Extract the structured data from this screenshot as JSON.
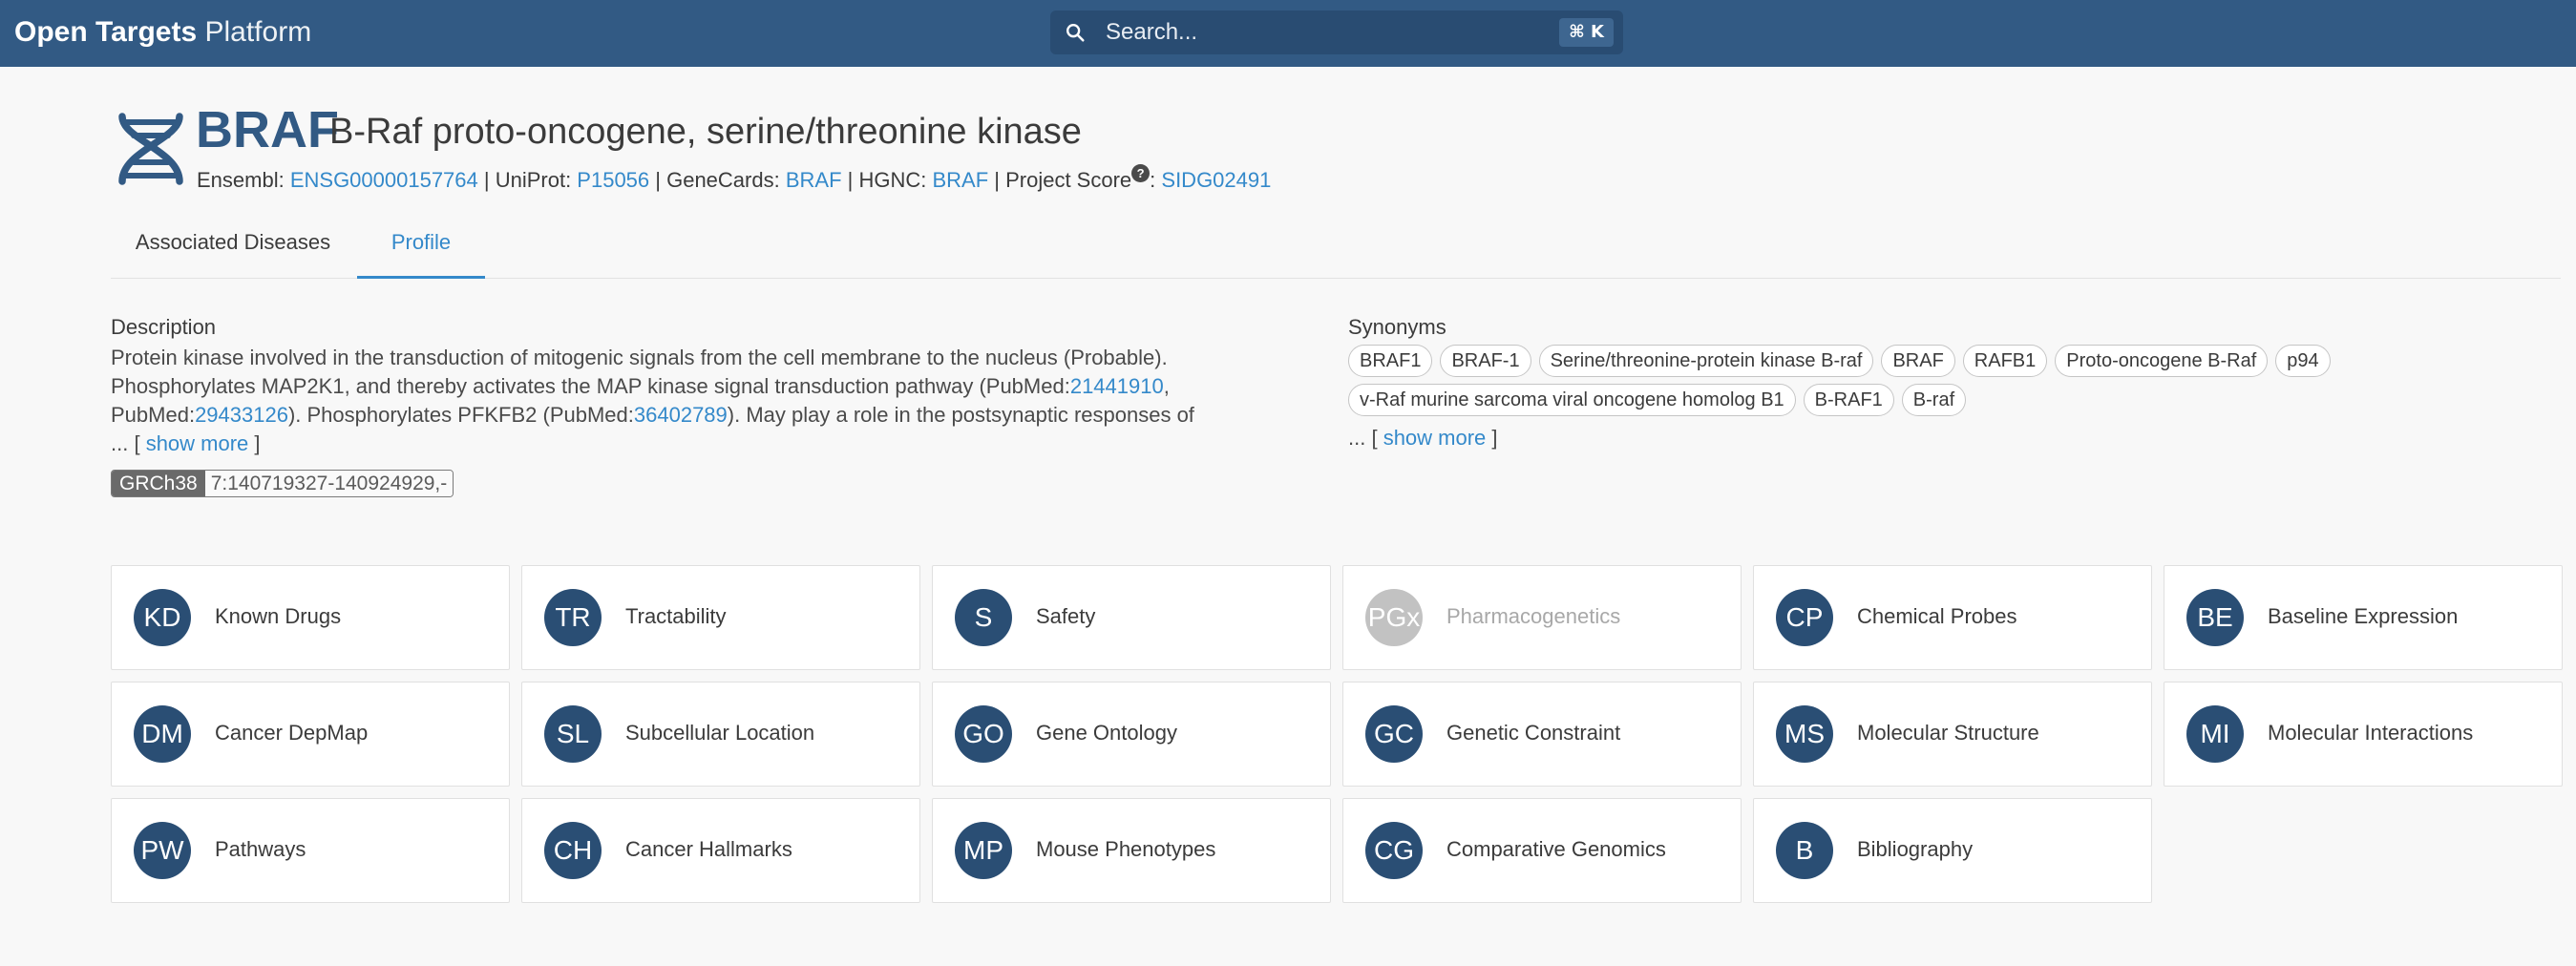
{
  "app": {
    "brand_bold": "Open Targets",
    "brand_light": " Platform"
  },
  "search": {
    "placeholder": "Search...",
    "shortcut": "⌘ K",
    "icon": "search-icon"
  },
  "target": {
    "symbol": "BRAF",
    "name": "B-Raf proto-oncogene, serine/threonine kinase",
    "icon": "dna-icon",
    "xrefs": {
      "ensembl_label": "Ensembl: ",
      "ensembl_id": "ENSG00000157764",
      "uniprot_label": " | UniProt: ",
      "uniprot_id": "P15056",
      "genecards_label": " | GeneCards: ",
      "genecards_id": "BRAF",
      "hgnc_label": " | HGNC: ",
      "hgnc_id": "BRAF",
      "projectscore_label": " | Project Score",
      "help": "?",
      "colon": ": ",
      "projectscore_id": "SIDG02491"
    }
  },
  "tabs": [
    {
      "label": "Associated Diseases",
      "active": false
    },
    {
      "label": "Profile",
      "active": true
    }
  ],
  "description": {
    "title": "Description",
    "part1": "Protein kinase involved in the transduction of mitogenic signals from the cell membrane to the nucleus (Probable). Phosphorylates MAP2K1, and thereby activates the MAP kinase signal transduction pathway (PubMed:",
    "pmid1": "21441910",
    "part2": ", PubMed:",
    "pmid2": "29433126",
    "part3": "). Phosphorylates PFKFB2 (PubMed:",
    "pmid3": "36402789",
    "part4": "). May play a role in the postsynaptic responses of",
    "more_prefix": "... [ ",
    "more_link": "show more",
    "more_suffix": " ]"
  },
  "location": {
    "assembly": "GRCh38",
    "coordinates": "7:140719327-140924929,-"
  },
  "synonyms": {
    "title": "Synonyms",
    "items": [
      "BRAF1",
      "BRAF-1",
      "Serine/threonine-protein kinase B-raf",
      "BRAF",
      "RAFB1",
      "Proto-oncogene B-Raf",
      "p94",
      "v-Raf murine sarcoma viral oncogene homolog B1",
      "B-RAF1",
      "B-raf"
    ],
    "more_prefix": "... [ ",
    "more_link": "show more",
    "more_suffix": " ]"
  },
  "widgets": [
    {
      "abbr": "KD",
      "label": "Known Drugs",
      "enabled": true
    },
    {
      "abbr": "TR",
      "label": "Tractability",
      "enabled": true
    },
    {
      "abbr": "S",
      "label": "Safety",
      "enabled": true
    },
    {
      "abbr": "PGx",
      "label": "Pharmacogenetics",
      "enabled": false
    },
    {
      "abbr": "CP",
      "label": "Chemical Probes",
      "enabled": true
    },
    {
      "abbr": "BE",
      "label": "Baseline Expression",
      "enabled": true
    },
    {
      "abbr": "DM",
      "label": "Cancer DepMap",
      "enabled": true
    },
    {
      "abbr": "SL",
      "label": "Subcellular Location",
      "enabled": true
    },
    {
      "abbr": "GO",
      "label": "Gene Ontology",
      "enabled": true
    },
    {
      "abbr": "GC",
      "label": "Genetic Constraint",
      "enabled": true
    },
    {
      "abbr": "MS",
      "label": "Molecular Structure",
      "enabled": true
    },
    {
      "abbr": "MI",
      "label": "Molecular Interactions",
      "enabled": true
    },
    {
      "abbr": "PW",
      "label": "Pathways",
      "enabled": true
    },
    {
      "abbr": "CH",
      "label": "Cancer Hallmarks",
      "enabled": true
    },
    {
      "abbr": "MP",
      "label": "Mouse Phenotypes",
      "enabled": true
    },
    {
      "abbr": "CG",
      "label": "Comparative Genomics",
      "enabled": true
    },
    {
      "abbr": "B",
      "label": "Bibliography",
      "enabled": true
    }
  ],
  "colors": {
    "topbar": "#325a84",
    "accent": "#3489ca",
    "badge": "#2a4e74",
    "badge_disabled": "#c2c2c2"
  }
}
